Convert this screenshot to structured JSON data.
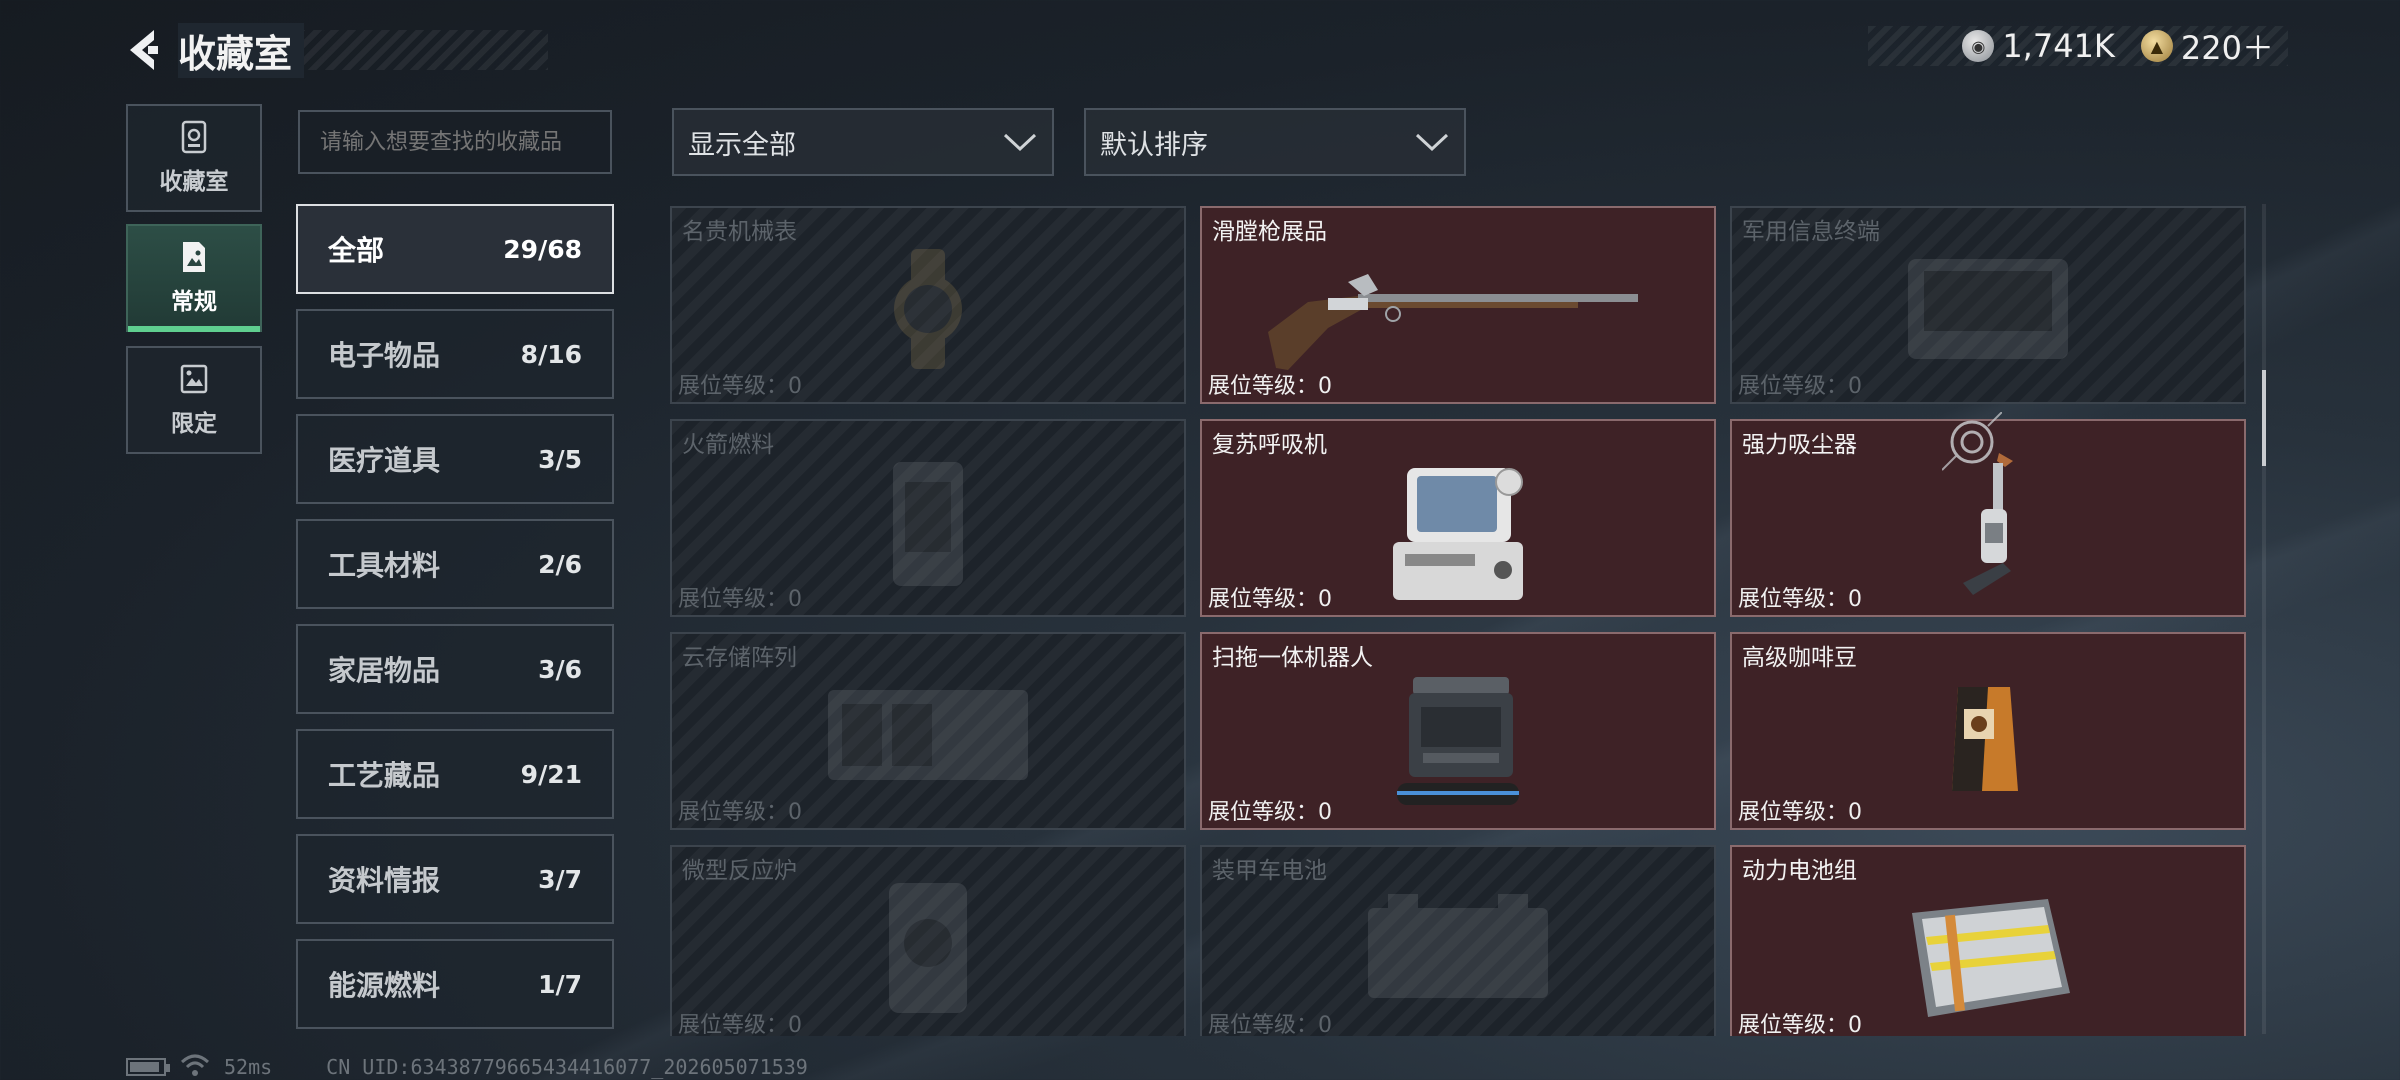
{
  "header": {
    "title": "收藏室",
    "currencies": [
      {
        "icon": "silver-coin-icon",
        "value": "1,741K"
      },
      {
        "icon": "gold-coin-icon",
        "value": "220＋"
      }
    ]
  },
  "side_tabs": [
    {
      "label": "收藏室",
      "icon": "vault-icon",
      "active": false
    },
    {
      "label": "常规",
      "icon": "picture-frame-icon",
      "active": true
    },
    {
      "label": "限定",
      "icon": "limited-frame-icon",
      "active": false
    }
  ],
  "search": {
    "placeholder": "请输入想要查找的收藏品"
  },
  "categories": [
    {
      "name": "全部",
      "count": "29/68",
      "active": true
    },
    {
      "name": "电子物品",
      "count": "8/16"
    },
    {
      "name": "医疗道具",
      "count": "3/5"
    },
    {
      "name": "工具材料",
      "count": "2/6"
    },
    {
      "name": "家居物品",
      "count": "3/6"
    },
    {
      "name": "工艺藏品",
      "count": "9/21"
    },
    {
      "name": "资料情报",
      "count": "3/7"
    },
    {
      "name": "能源燃料",
      "count": "1/7"
    }
  ],
  "filters": {
    "display": "显示全部",
    "sort": "默认排序"
  },
  "items": [
    {
      "name": "名贵机械表",
      "level": "展位等级：0",
      "owned": false,
      "icon": "watch-icon"
    },
    {
      "name": "滑膛枪展品",
      "level": "展位等级：0",
      "owned": true,
      "icon": "musket-icon"
    },
    {
      "name": "军用信息终端",
      "level": "展位等级：0",
      "owned": false,
      "icon": "terminal-case-icon"
    },
    {
      "name": "火箭燃料",
      "level": "展位等级：0",
      "owned": false,
      "icon": "fuel-canister-icon"
    },
    {
      "name": "复苏呼吸机",
      "level": "展位等级：0",
      "owned": true,
      "icon": "ventilator-icon"
    },
    {
      "name": "强力吸尘器",
      "level": "展位等级：0",
      "owned": true,
      "icon": "vacuum-cleaner-icon"
    },
    {
      "name": "云存储阵列",
      "level": "展位等级：0",
      "owned": false,
      "icon": "server-array-icon"
    },
    {
      "name": "扫拖一体机器人",
      "level": "展位等级：0",
      "owned": true,
      "icon": "robot-station-icon"
    },
    {
      "name": "高级咖啡豆",
      "level": "展位等级：0",
      "owned": true,
      "icon": "coffee-bag-icon"
    },
    {
      "name": "微型反应炉",
      "level": "展位等级：0",
      "owned": false,
      "icon": "reactor-icon"
    },
    {
      "name": "装甲车电池",
      "level": "展位等级：0",
      "owned": false,
      "icon": "vehicle-battery-icon"
    },
    {
      "name": "动力电池组",
      "level": "展位等级：0",
      "owned": true,
      "icon": "battery-pack-icon"
    }
  ],
  "status_bar": {
    "ping": "52ms",
    "uid": "CN UID:634387796654344160​77_202605071539"
  }
}
